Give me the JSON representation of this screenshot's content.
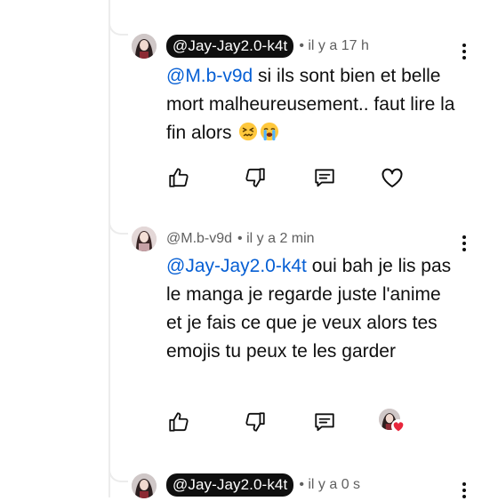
{
  "comments": [
    {
      "handle": "@Jay-Jay2.0-k4t",
      "time": "• il y a 17 h",
      "mention": "@M.b-v9d",
      "text": " si ils sont bien et belle mort malheureusement.. faut lire la fin alors ",
      "emojis": [
        "confounded-face",
        "loudly-crying-face"
      ]
    },
    {
      "handle": "@M.b-v9d",
      "time": "• il y a 2 min",
      "mention": "@Jay-Jay2.0-k4t",
      "text": " oui bah je lis pas le manga je regarde juste l'anime et je fais ce que je veux alors tes emojis tu peux te les garder",
      "creator_heart": true
    },
    {
      "handle": "@Jay-Jay2.0-k4t",
      "time": "• il y a 0 s"
    }
  ],
  "icons": {
    "like": "thumbs-up-icon",
    "dislike": "thumbs-down-icon",
    "reply": "reply-icon",
    "heart": "heart-icon",
    "menu": "more-vertical-icon"
  },
  "colors": {
    "mention": "#065fd4",
    "heart": "#e8263c",
    "chip": "#0f0f0f"
  }
}
